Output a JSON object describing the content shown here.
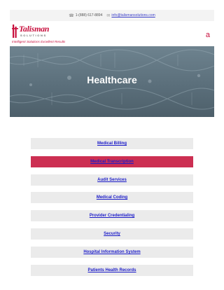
{
  "topbar": {
    "phone_icon": "phone-icon",
    "phone": "1-(888) 617-8894",
    "email_icon": "mail-icon",
    "email": "info@talismansolutions.com"
  },
  "brand": {
    "name": "Talisman",
    "sub": "SOLUTIONS",
    "tagline": "Intelligent Solutions Excellent Results",
    "color": "#c8103e"
  },
  "menu_toggle": "a",
  "hero": {
    "title": "Healthcare"
  },
  "services": [
    {
      "label": "Medical Billing",
      "active": false
    },
    {
      "label": "Medical Transcription",
      "active": true
    },
    {
      "label": "Audit Services",
      "active": false
    },
    {
      "label": "Medical Coding",
      "active": false
    },
    {
      "label": "Provider Credentialing",
      "active": false
    },
    {
      "label": "Security",
      "active": false
    },
    {
      "label": "Hospital Information System",
      "active": false
    },
    {
      "label": "Patients Health Records",
      "active": false
    }
  ],
  "colors": {
    "accent": "#cc2f52",
    "link": "#1a1ac8",
    "button_bg": "#ebebeb"
  }
}
